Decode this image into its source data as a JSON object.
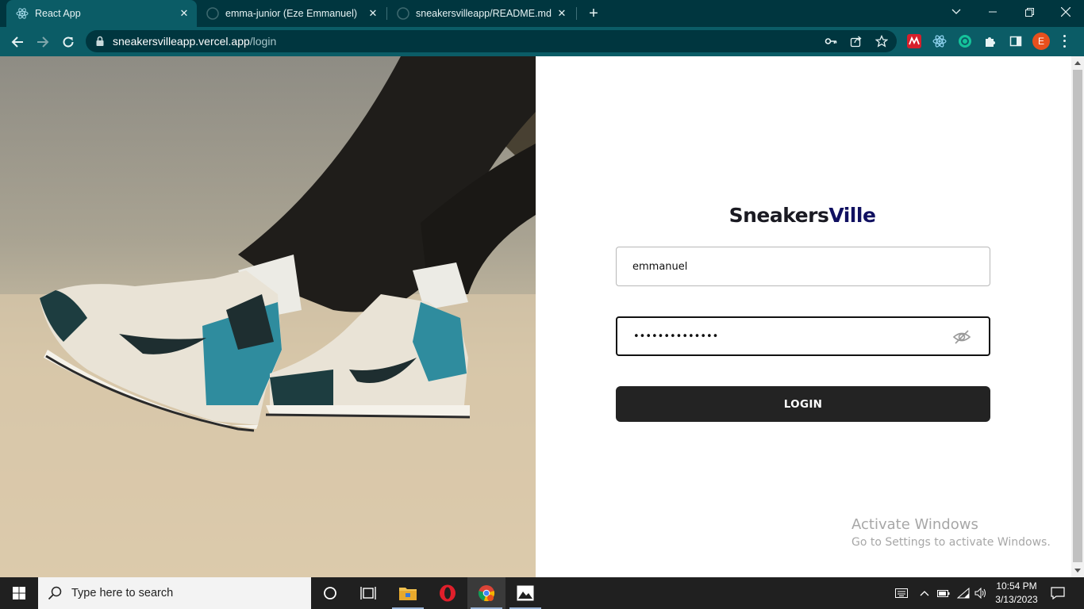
{
  "browser": {
    "tabs": [
      {
        "title": "React App",
        "active": true
      },
      {
        "title": "emma-junior (Eze Emmanuel)",
        "active": false
      },
      {
        "title": "sneakersvilleapp/README.md at",
        "active": false
      }
    ],
    "url_host": "sneakersvilleapp.vercel.app",
    "url_path": "/login",
    "profile_initial": "E",
    "colors": {
      "frame": "#00363f",
      "toolbar": "#0b5c66"
    }
  },
  "page": {
    "brand_part1": "Sneakers",
    "brand_part2": "Ville",
    "username_value": "emmanuel",
    "password_value": "••••••••••••••",
    "login_label": "LOGIN",
    "colors": {
      "brand": "#1a1a22",
      "brand_accent": "#101060",
      "button": "#232323"
    }
  },
  "watermark": {
    "line1": "Activate Windows",
    "line2": "Go to Settings to activate Windows."
  },
  "taskbar": {
    "search_placeholder": "Type here to search",
    "time": "10:54 PM",
    "date": "3/13/2023"
  }
}
